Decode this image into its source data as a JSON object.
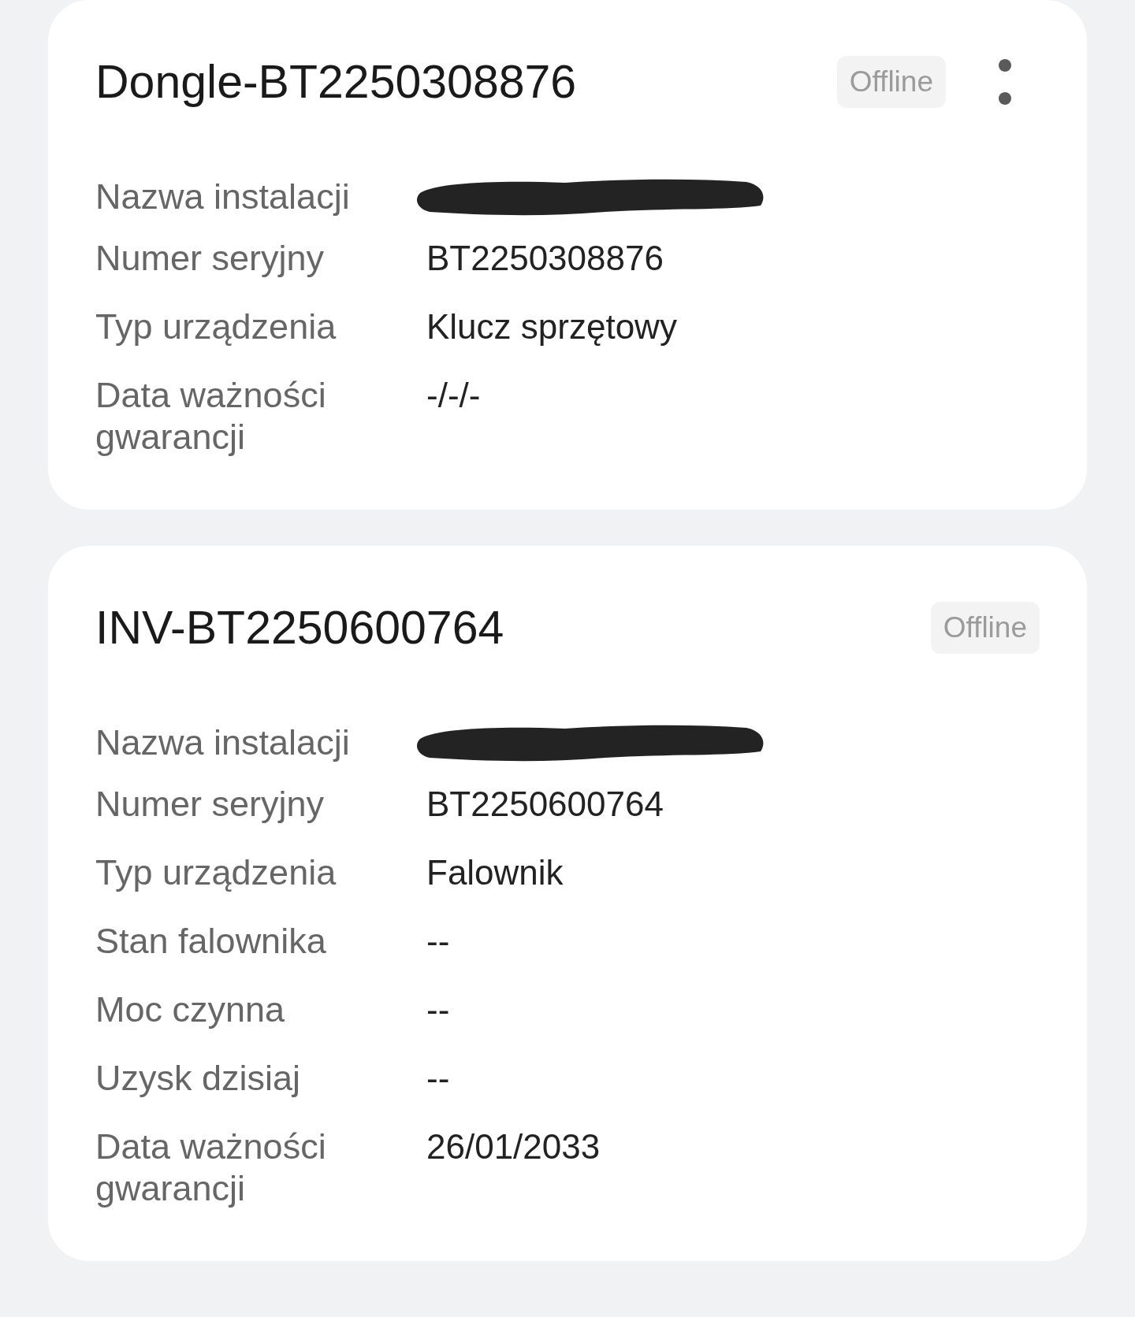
{
  "devices": [
    {
      "title": "Dongle-BT2250308876",
      "status": "Offline",
      "menu_button": true,
      "fields": [
        {
          "label": "Nazwa instalacji",
          "kind": "redacted"
        },
        {
          "label": "Numer seryjny",
          "kind": "text",
          "value": "BT2250308876"
        },
        {
          "label": "Typ urządzenia",
          "kind": "text",
          "value": "Klucz sprzętowy"
        },
        {
          "label": "Data ważności gwarancji",
          "kind": "text",
          "value": "-/-/-"
        }
      ]
    },
    {
      "title": "INV-BT2250600764",
      "status": "Offline",
      "menu_button": false,
      "fields": [
        {
          "label": "Nazwa instalacji",
          "kind": "redacted"
        },
        {
          "label": "Numer seryjny",
          "kind": "text",
          "value": "BT2250600764"
        },
        {
          "label": "Typ urządzenia",
          "kind": "text",
          "value": "Falownik"
        },
        {
          "label": "Stan falownika",
          "kind": "text",
          "value": "--"
        },
        {
          "label": "Moc czynna",
          "kind": "text",
          "value": "--"
        },
        {
          "label": "Uzysk dzisiaj",
          "kind": "text",
          "value": "--"
        },
        {
          "label": "Data ważności gwarancji",
          "kind": "text",
          "value": "26/01/2033"
        }
      ]
    }
  ]
}
